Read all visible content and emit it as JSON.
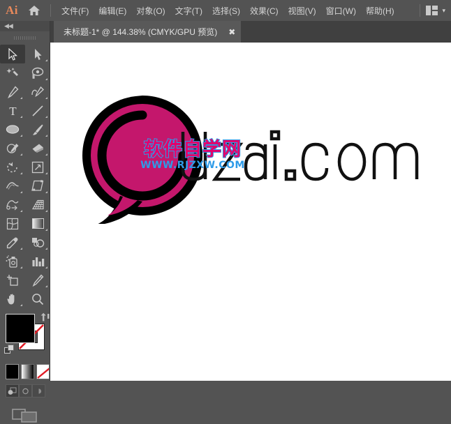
{
  "app": {
    "name": "Ai",
    "logo_color": "#E8895B",
    "home_icon": "home-icon"
  },
  "menubar": {
    "items": [
      {
        "label": "文件(F)",
        "name": "menu-file"
      },
      {
        "label": "编辑(E)",
        "name": "menu-edit"
      },
      {
        "label": "对象(O)",
        "name": "menu-object"
      },
      {
        "label": "文字(T)",
        "name": "menu-type"
      },
      {
        "label": "选择(S)",
        "name": "menu-select"
      },
      {
        "label": "效果(C)",
        "name": "menu-effect"
      },
      {
        "label": "视图(V)",
        "name": "menu-view"
      },
      {
        "label": "窗口(W)",
        "name": "menu-window"
      },
      {
        "label": "帮助(H)",
        "name": "menu-help"
      }
    ],
    "workspace_icon": "workspace-layout-icon",
    "workspace_chevron": "▾"
  },
  "tabbar": {
    "tab_label": "未标题-1* @ 144.38% (CMYK/GPU 预览)",
    "close_label": "✖",
    "document_name": "未标题-1",
    "modified": "*",
    "zoom_level": "144.38%",
    "color_mode": "CMYK/GPU 预览"
  },
  "toolpanel": {
    "collapse_label": "◀◀",
    "tools": [
      {
        "name": "selection-tool",
        "active": true
      },
      {
        "name": "direct-selection-tool",
        "active": false
      },
      {
        "name": "magic-wand-tool",
        "active": false
      },
      {
        "name": "lasso-tool",
        "active": false
      },
      {
        "name": "pen-tool",
        "active": false
      },
      {
        "name": "curvature-tool",
        "active": false
      },
      {
        "name": "type-tool",
        "active": false
      },
      {
        "name": "line-segment-tool",
        "active": false
      },
      {
        "name": "ellipse-tool",
        "active": false
      },
      {
        "name": "paintbrush-tool",
        "active": false
      },
      {
        "name": "shaper-tool",
        "active": false
      },
      {
        "name": "eraser-tool",
        "active": false
      },
      {
        "name": "rotate-tool",
        "active": false
      },
      {
        "name": "scale-tool",
        "active": false
      },
      {
        "name": "width-tool",
        "active": false
      },
      {
        "name": "free-transform-tool",
        "active": false
      },
      {
        "name": "shape-builder-tool",
        "active": false
      },
      {
        "name": "perspective-grid-tool",
        "active": false
      },
      {
        "name": "mesh-tool",
        "active": false
      },
      {
        "name": "gradient-tool",
        "active": false
      },
      {
        "name": "eyedropper-tool",
        "active": false
      },
      {
        "name": "blend-tool",
        "active": false
      },
      {
        "name": "symbol-sprayer-tool",
        "active": false
      },
      {
        "name": "column-graph-tool",
        "active": false
      },
      {
        "name": "artboard-tool",
        "active": false
      },
      {
        "name": "slice-tool",
        "active": false
      },
      {
        "name": "hand-tool",
        "active": false
      },
      {
        "name": "zoom-tool",
        "active": false
      }
    ],
    "fill_color": "#000000",
    "stroke_color": "none",
    "swap_icon": "swap-fill-stroke-icon",
    "default_icon": "default-fill-stroke-icon",
    "color_modes": [
      {
        "name": "color-mode-button",
        "kind": "black"
      },
      {
        "name": "gradient-mode-button",
        "kind": "gradient"
      },
      {
        "name": "none-mode-button",
        "kind": "none"
      }
    ],
    "draw_modes": [
      {
        "name": "draw-normal-button",
        "selected": true
      },
      {
        "name": "draw-behind-button",
        "selected": false
      },
      {
        "name": "draw-inside-button",
        "selected": false
      }
    ],
    "screen_mode": "change-screen-mode-icon"
  },
  "canvas": {
    "background": "#ffffff",
    "artwork": {
      "name": "uzai-logo-artwork",
      "bubble_color": "#C4176C",
      "outline_color": "#000000",
      "wordmark_text": "uzai.com",
      "wordmark_style": "outline"
    },
    "watermark": {
      "name": "site-watermark",
      "cn_text": "软件自学网",
      "url_text": "WWW.RJZXW.COM",
      "cn_color": "#E4006A",
      "stroke_color": "#2E9BE8",
      "url_color": "#2E9BE8"
    }
  }
}
